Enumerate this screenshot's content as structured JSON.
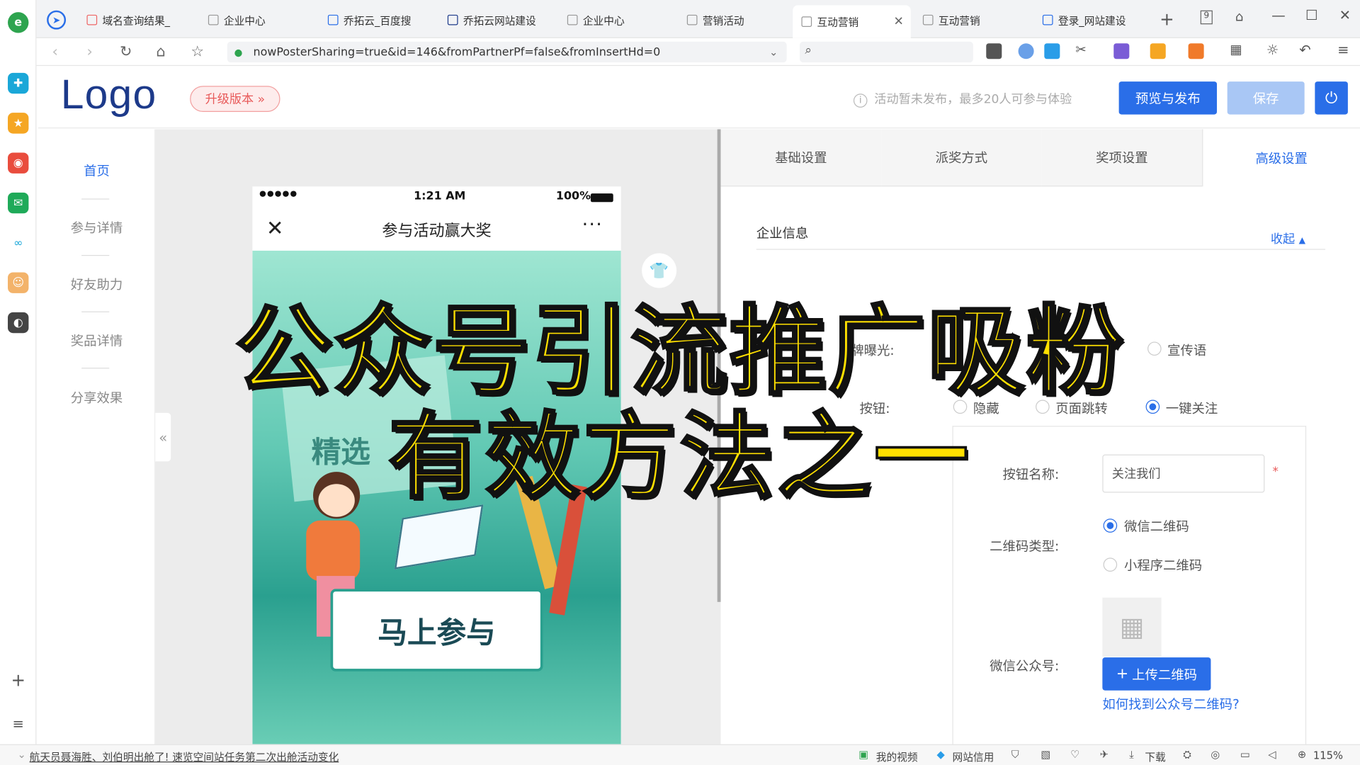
{
  "browser": {
    "tabs": [
      {
        "label": "域名查询结果_"
      },
      {
        "label": "企业中心"
      },
      {
        "label": "乔拓云_百度搜"
      },
      {
        "label": "乔拓云网站建设"
      },
      {
        "label": "企业中心"
      },
      {
        "label": "营销活动"
      },
      {
        "label": "互动营销",
        "active": true
      },
      {
        "label": "互动营销"
      },
      {
        "label": "登录_网站建设"
      }
    ],
    "tab_count": "9",
    "url": "nowPosterSharing=true&id=146&fromPartnerPf=false&fromInsertHd=0"
  },
  "header": {
    "logo": "Logo",
    "upgrade_label": "升级版本 »",
    "hint": "活动暂未发布，最多20人可参与体验",
    "publish_label": "预览与发布",
    "save_label": "保存"
  },
  "sidenav": {
    "items": [
      {
        "label": "首页",
        "active": true
      },
      {
        "label": "参与详情"
      },
      {
        "label": "好友助力"
      },
      {
        "label": "奖品详情"
      },
      {
        "label": "分享效果"
      }
    ],
    "collapse_glyph": "«"
  },
  "phone": {
    "signal": "●●●●●",
    "time": "1:21 AM",
    "battery": "100%",
    "title": "参与活动赢大奖",
    "banner_text": "精选",
    "cta": "马上参与"
  },
  "settings": {
    "tabs": [
      {
        "label": "基础设置"
      },
      {
        "label": "派奖方式"
      },
      {
        "label": "奖项设置"
      },
      {
        "label": "高级设置",
        "active": true
      }
    ],
    "section_title": "企业信息",
    "collapse_label": "收起",
    "brand_exposure_label": "牌曝光:",
    "slogan_option": "宣传语",
    "button_label": "按钮:",
    "button_options": [
      {
        "label": "隐藏",
        "selected": false
      },
      {
        "label": "页面跳转",
        "selected": false
      },
      {
        "label": "一键关注",
        "selected": true
      }
    ],
    "button_name_label": "按钮名称:",
    "button_name_value": "关注我们",
    "required_mark": "*",
    "qr_type_label": "二维码类型:",
    "qr_options": [
      {
        "label": "微信二维码",
        "selected": true
      },
      {
        "label": "小程序二维码",
        "selected": false
      }
    ],
    "wechat_label": "微信公众号:",
    "upload_label": "上传二维码",
    "how_to_link": "如何找到公众号二维码?"
  },
  "overlay": {
    "line1": "公众号引流推广吸粉",
    "line2": "有效方法之一"
  },
  "statusbar": {
    "news": "航天员聂海胜、刘伯明出舱了! 速览空间站任务第二次出舱活动变化",
    "my_video": "我的视频",
    "site_credit": "网站信用",
    "download": "下载",
    "zoom": "115%"
  },
  "colors": {
    "accent": "#2a6ee8",
    "overlay_text": "#ffe000",
    "logo": "#1d3a8a"
  }
}
